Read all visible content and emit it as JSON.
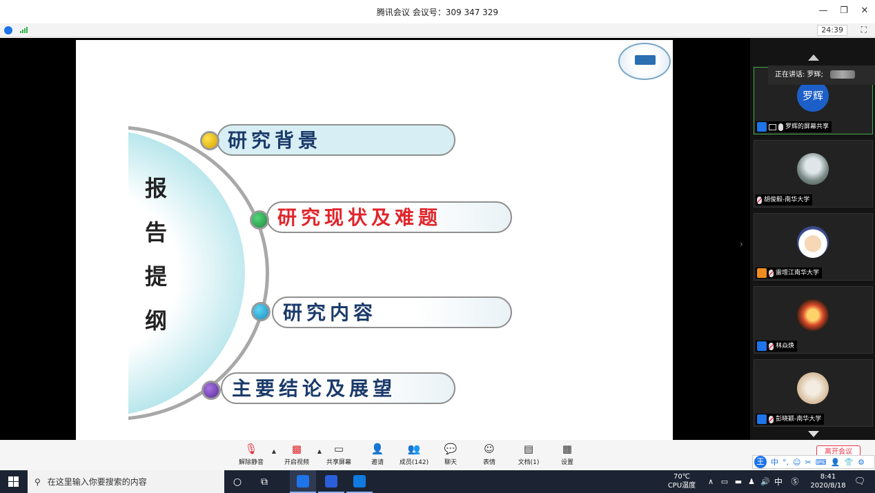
{
  "window": {
    "title": "腾讯会议 会议号：309 347 329",
    "minimize": "—",
    "restore": "❐",
    "close": "✕"
  },
  "status": {
    "timer": "24:39",
    "fullscreen": "⛶"
  },
  "slide": {
    "vertical_title": [
      "报",
      "告",
      "提",
      "纲"
    ],
    "items": [
      {
        "label": "研究背景"
      },
      {
        "label": "研究现状及难题"
      },
      {
        "label": "研究内容"
      },
      {
        "label": "主要结论及展望"
      }
    ]
  },
  "panel": {
    "speaking_label": "正在讲话: 罗辉;",
    "participants": [
      {
        "avatar_text": "罗辉",
        "name": "罗辉的屏幕共享"
      },
      {
        "name": "胡俊毅-南华大学"
      },
      {
        "name": "雷增江南华大学"
      },
      {
        "name": "林焱焕"
      },
      {
        "name": "彭晓颖-南华大学"
      }
    ]
  },
  "toolbar": {
    "unmute": "解除静音",
    "start_video": "开启视频",
    "share_screen": "共享屏幕",
    "invite": "邀请",
    "members": "成员(142)",
    "chat": "聊天",
    "reactions": "表情",
    "docs": "文档(1)",
    "settings": "设置",
    "end": "离开会议"
  },
  "ime": {
    "logo": "王",
    "mode": "中"
  },
  "taskbar": {
    "search_placeholder": "在这里输入你要搜索的内容",
    "temp": "70℃",
    "temp_label": "CPU温度",
    "ime_lang": "中",
    "time": "8:41",
    "date": "2020/8/18"
  },
  "colors": {
    "accent_blue": "#1e74e8",
    "active_green": "#3fae49",
    "danger_red": "#e0262c"
  }
}
